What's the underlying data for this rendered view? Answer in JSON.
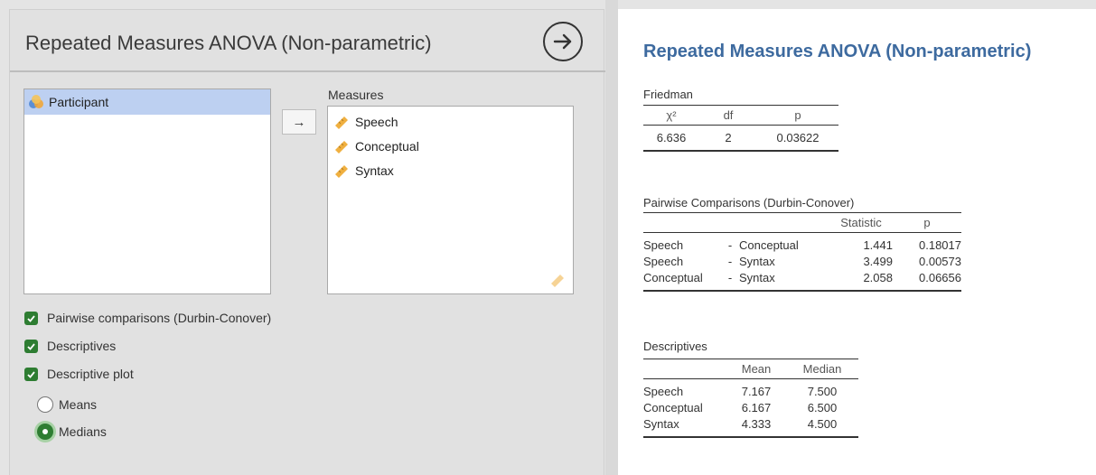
{
  "left_panel": {
    "title": "Repeated Measures ANOVA (Non-parametric)",
    "variables": [
      {
        "label": "Participant",
        "icon": "nominal-variable-icon"
      }
    ],
    "move_button": "→",
    "measures_label": "Measures",
    "measures": [
      {
        "label": "Speech",
        "icon": "continuous-variable-icon"
      },
      {
        "label": "Conceptual",
        "icon": "continuous-variable-icon"
      },
      {
        "label": "Syntax",
        "icon": "continuous-variable-icon"
      }
    ],
    "options": {
      "pairwise": "Pairwise comparisons (Durbin-Conover)",
      "descriptives": "Descriptives",
      "descriptive_plot": "Descriptive plot",
      "means": "Means",
      "medians": "Medians"
    }
  },
  "right_panel": {
    "title": "Repeated Measures ANOVA (Non-parametric)",
    "friedman": {
      "caption": "Friedman",
      "headers": [
        "χ²",
        "df",
        "p"
      ],
      "row": [
        "6.636",
        "2",
        "0.03622"
      ]
    },
    "pairwise": {
      "caption": "Pairwise Comparisons (Durbin-Conover)",
      "headers": [
        "Statistic",
        "p"
      ],
      "rows": [
        [
          "Speech",
          "-",
          "Conceptual",
          "1.441",
          "0.18017"
        ],
        [
          "Speech",
          "-",
          "Syntax",
          "3.499",
          "0.00573"
        ],
        [
          "Conceptual",
          "-",
          "Syntax",
          "2.058",
          "0.06656"
        ]
      ]
    },
    "descriptives": {
      "caption": "Descriptives",
      "headers": [
        "Mean",
        "Median"
      ],
      "rows": [
        [
          "Speech",
          "7.167",
          "7.500"
        ],
        [
          "Conceptual",
          "6.167",
          "6.500"
        ],
        [
          "Syntax",
          "4.333",
          "4.500"
        ]
      ]
    }
  },
  "colors": {
    "accent_green": "#2e7d32",
    "title_blue": "#3d6a9f",
    "selection": "#bdd0f1"
  }
}
